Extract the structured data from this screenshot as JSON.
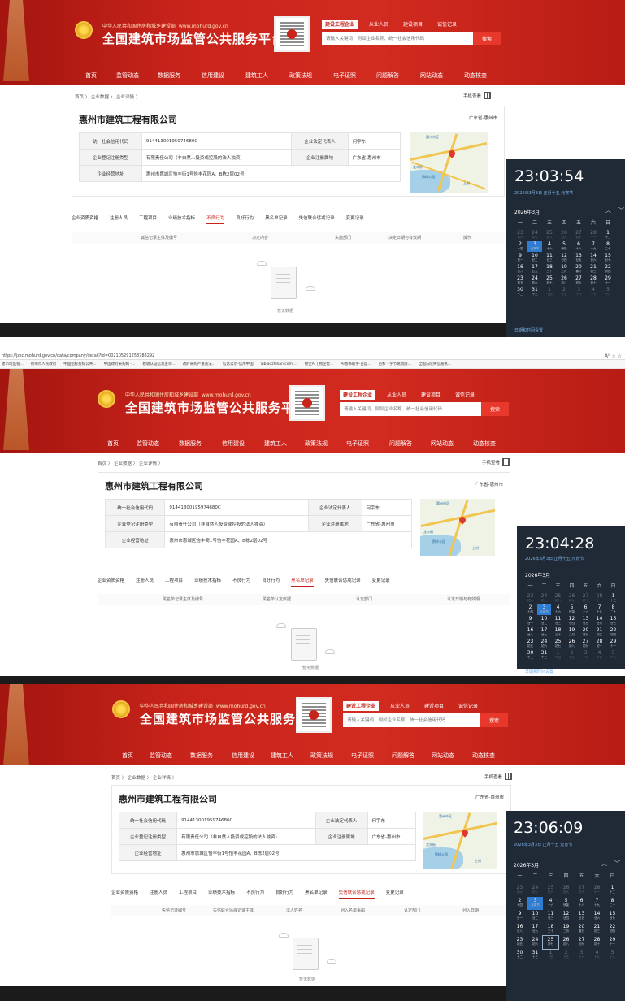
{
  "header": {
    "ministry": "中华人民共和国住房和城乡建设部",
    "site_url": "www.mohurd.gov.cn",
    "site_title": "全国建筑市场监管公共服务平台",
    "search_tabs": [
      "建设工程企业",
      "从业人员",
      "建设项目",
      "诚信记录"
    ],
    "search_placeholder": "请输入关键词，例如企业名称、统一社会信用代码",
    "search_button": "搜索"
  },
  "nav": [
    "首页",
    "监管动态",
    "数据服务",
    "信用建设",
    "建筑工人",
    "政策法规",
    "电子证照",
    "问题解答",
    "网站动态",
    "动态核查"
  ],
  "breadcrumb": "首页 〉 企业数据 〉 企业详情 〉",
  "mobile_view": "手机查看",
  "company": {
    "name": "惠州市建筑工程有限公司",
    "location": "广东省-惠州市",
    "credit_code_label": "统一社会信用代码",
    "credit_code": "91441300195974680C",
    "legal_rep_label": "企业法定代表人",
    "legal_rep": "何宇东",
    "reg_type_label": "企业登记注册类型",
    "reg_type": "有限责任公司（非自然人投资或控股的法人独资）",
    "reg_place_label": "企业注册属地",
    "reg_place": "广东省-惠州市",
    "address_label": "企业经营地址",
    "address": "惠州市惠城区怡丰街1号怡丰花园A、B栋2层02号"
  },
  "map": {
    "label1": "惠州市区",
    "label2": "鹅岭公园",
    "label3": "龙丰街",
    "label4": "上村"
  },
  "tabs": [
    "企业资质资格",
    "注册人员",
    "工程项目",
    "业绩技术指标",
    "不良行为",
    "良好行为",
    "黑名单记录",
    "失信联合惩戒记录",
    "变更记录"
  ],
  "shots": [
    {
      "active_tab": "不良行为",
      "columns": [
        "诚信记录主体及编号",
        "决定内容",
        "实施部门",
        "决定日期与有效期",
        "操作"
      ],
      "empty": "暂无数据",
      "clock": {
        "time": "23:03:54",
        "date": "2026年3月3日 正月十五 元宵节"
      }
    },
    {
      "active_tab": "黑名单记录",
      "columns": [
        "黑名单记录主体及编号",
        "黑名单认定依据",
        "认定部门",
        "认定日期与有效期"
      ],
      "empty": "暂无数据",
      "clock": {
        "time": "23:04:28",
        "date": "2026年3月3日 正月十五 元宵节"
      }
    },
    {
      "active_tab": "失信联合惩戒记录",
      "columns": [
        "失信记录编号",
        "失信联合惩戒记录主体",
        "法人姓名",
        "列入名单事由",
        "认定部门",
        "列入日期"
      ],
      "empty": "暂无数据",
      "clock": {
        "time": "23:06:09",
        "date": "2026年3月3日 正月十五 元宵节"
      }
    }
  ],
  "browser": {
    "url": "https://jzsc.mohurd.gov.cn/data/company/detail?id=002105291258788292",
    "bookmarks": [
      "建市场监管...",
      "徐州市人民政府",
      "中国招标投标公共...",
      "中国政府采购网 -...",
      "税收认证信息查询...",
      "政府采购严重违法...",
      "信息公示-信用中国",
      "aibiaozhilian.com/...",
      "物企AI | 物企智...",
      "AI图书助手-百度...",
      "百杉 - 字节跳动旗...",
      "全国法院失信被执..."
    ]
  },
  "calendar": {
    "month_label": "2026年3月",
    "weekdays": [
      "一",
      "二",
      "三",
      "四",
      "五",
      "六",
      "日"
    ],
    "days": [
      [
        "23",
        "初六",
        1
      ],
      [
        "24",
        "初七",
        1
      ],
      [
        "25",
        "初八",
        1
      ],
      [
        "26",
        "初九",
        1
      ],
      [
        "27",
        "初十",
        1
      ],
      [
        "28",
        "十一",
        1
      ],
      [
        "1",
        "十二",
        0
      ],
      [
        "2",
        "十四",
        0
      ],
      [
        "3",
        "元宵节",
        0
      ],
      [
        "4",
        "十六",
        0
      ],
      [
        "5",
        "惊蛰",
        0
      ],
      [
        "6",
        "十八",
        0
      ],
      [
        "7",
        "十九",
        0
      ],
      [
        "8",
        "二十",
        0
      ],
      [
        "9",
        "廿一",
        0
      ],
      [
        "10",
        "廿二",
        0
      ],
      [
        "11",
        "廿三",
        0
      ],
      [
        "12",
        "廿四",
        0
      ],
      [
        "13",
        "廿五",
        0
      ],
      [
        "14",
        "廿六",
        0
      ],
      [
        "15",
        "廿七",
        0
      ],
      [
        "16",
        "廿八",
        0
      ],
      [
        "17",
        "廿九",
        0
      ],
      [
        "18",
        "三十",
        0
      ],
      [
        "19",
        "二月",
        0
      ],
      [
        "20",
        "春分",
        0
      ],
      [
        "21",
        "初三",
        0
      ],
      [
        "22",
        "初四",
        0
      ],
      [
        "23",
        "初五",
        0
      ],
      [
        "24",
        "初六",
        0
      ],
      [
        "25",
        "初七",
        0
      ],
      [
        "26",
        "初八",
        0
      ],
      [
        "27",
        "初九",
        0
      ],
      [
        "28",
        "初十",
        0
      ],
      [
        "29",
        "十一",
        0
      ],
      [
        "30",
        "十二",
        0
      ],
      [
        "31",
        "十三",
        0
      ],
      [
        "1",
        "十四",
        1
      ],
      [
        "2",
        "十五",
        1
      ],
      [
        "3",
        "十六",
        1
      ],
      [
        "4",
        "十七",
        1
      ],
      [
        "5",
        "十八",
        1
      ]
    ],
    "footer": "日期和时间设置"
  }
}
